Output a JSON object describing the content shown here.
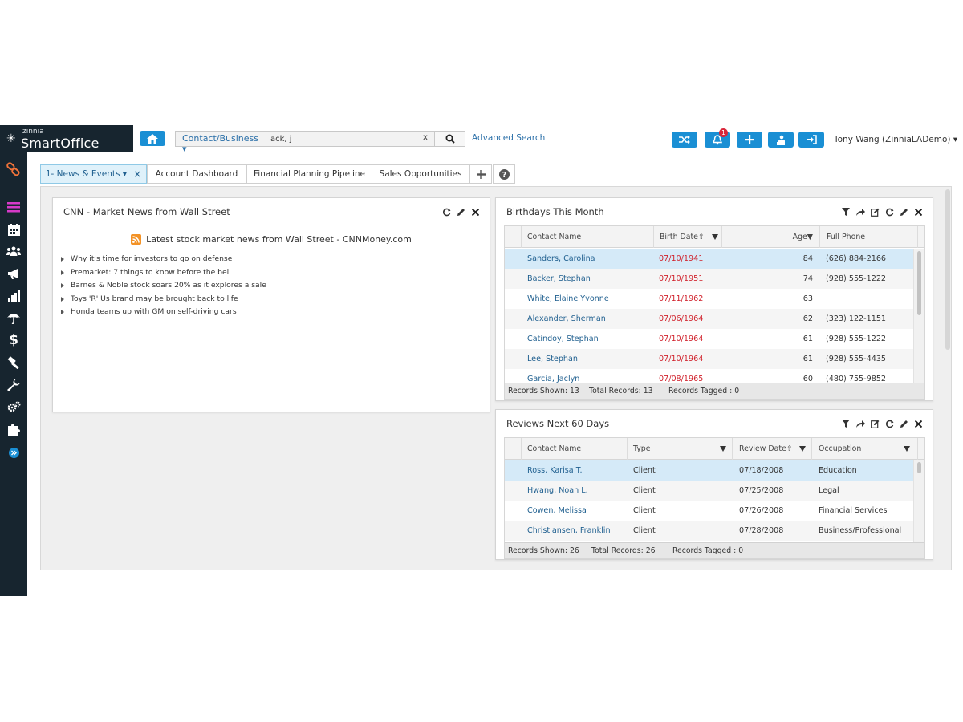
{
  "app": {
    "brand_small": "zinnia",
    "brand_main": "SmartOffice"
  },
  "search": {
    "type_label": "Contact/Business ▾",
    "value": "ack, j",
    "clear": "x",
    "advanced": "Advanced Search"
  },
  "toolbar": {
    "notifications_count": "1",
    "user": "Tony Wang (ZinniaLADemo) ▾"
  },
  "sidebar": {
    "icons": [
      "link-icon",
      "menu-icon",
      "calendar-icon",
      "people-icon",
      "megaphone-icon",
      "bar-chart-icon",
      "umbrella-icon",
      "dollar-icon",
      "hammer-icon",
      "wrench-icon",
      "gears-icon",
      "puzzle-icon",
      "expand-icon"
    ]
  },
  "tabs": [
    {
      "label": "1- News & Events ▾"
    },
    {
      "label": "Account Dashboard"
    },
    {
      "label": "Financial Planning Pipeline"
    },
    {
      "label": "Sales Opportunities"
    }
  ],
  "tab_close": "×",
  "news": {
    "title": "CNN - Market News from Wall Street",
    "feed_title": "Latest stock market news from Wall Street - CNNMoney.com",
    "items": [
      "Why it's time for investors to go on defense",
      "Premarket: 7 things to know before the bell",
      "Barnes & Noble stock soars 20% as it explores a sale",
      "Toys 'R' Us brand may be brought back to life",
      "Honda teams up with GM on self-driving cars"
    ]
  },
  "birthdays": {
    "title": "Birthdays This Month",
    "headers": {
      "name": "Contact Name",
      "birth": "Birth Date⇧",
      "age": "Age▼",
      "phone": "Full Phone"
    },
    "rows": [
      {
        "name": "Sanders, Carolina",
        "date": "07/10/1941",
        "age": "84",
        "phone": "(626) 884-2166"
      },
      {
        "name": "Backer, Stephan",
        "date": "07/10/1951",
        "age": "74",
        "phone": "(928) 555-1222"
      },
      {
        "name": "White, Elaine Yvonne",
        "date": "07/11/1962",
        "age": "63",
        "phone": ""
      },
      {
        "name": "Alexander, Sherman",
        "date": "07/06/1964",
        "age": "62",
        "phone": "(323) 122-1151"
      },
      {
        "name": "Catindoy, Stephan",
        "date": "07/10/1964",
        "age": "61",
        "phone": "(928) 555-1222"
      },
      {
        "name": "Lee, Stephan",
        "date": "07/10/1964",
        "age": "61",
        "phone": "(928) 555-4435"
      },
      {
        "name": "Garcia, Jaclyn",
        "date": "07/08/1965",
        "age": "60",
        "phone": "(480) 755-9852"
      }
    ],
    "footer": {
      "shown": "Records Shown: 13",
      "total": "Total Records: 13",
      "tagged": "Records Tagged : 0"
    }
  },
  "reviews": {
    "title": "Reviews Next 60 Days",
    "headers": {
      "name": "Contact Name",
      "type": "Type",
      "date": "Review Date⇧",
      "occupation": "Occupation"
    },
    "rows": [
      {
        "name": "Ross, Karisa T.",
        "type": "Client",
        "date": "07/18/2008",
        "occupation": "Education"
      },
      {
        "name": "Hwang, Noah L.",
        "type": "Client",
        "date": "07/25/2008",
        "occupation": "Legal"
      },
      {
        "name": "Cowen, Melissa",
        "type": "Client",
        "date": "07/26/2008",
        "occupation": "Financial Services"
      },
      {
        "name": "Christiansen, Franklin",
        "type": "Client",
        "date": "07/28/2008",
        "occupation": "Business/Professional"
      }
    ],
    "footer": {
      "shown": "Records Shown: 26",
      "total": "Total Records: 26",
      "tagged": "Records Tagged : 0"
    }
  },
  "colors": {
    "accent": "#1a8fd4",
    "sidebar": "#17252f",
    "link": "#1f5f8f",
    "date_red": "#d0202a",
    "selected_row": "#d5eaf8"
  }
}
